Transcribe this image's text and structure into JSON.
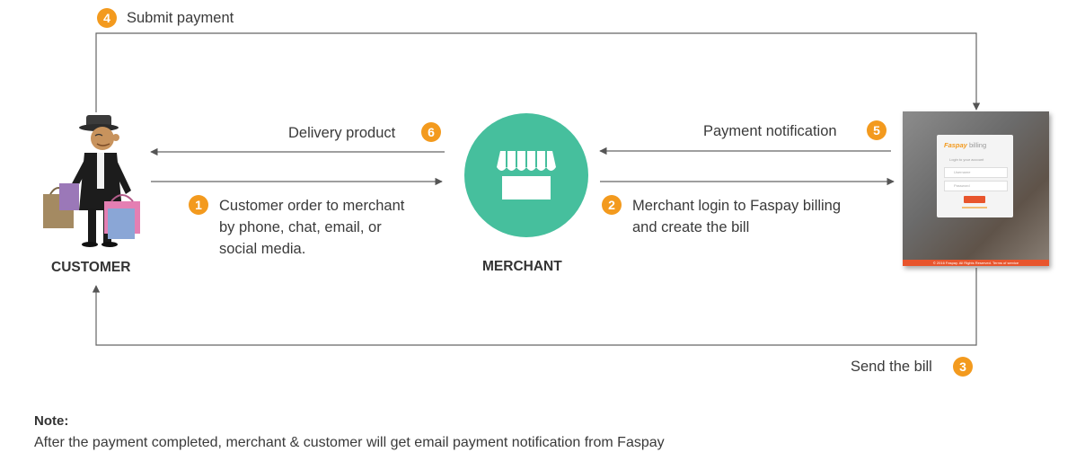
{
  "steps": {
    "s1": {
      "num": "1",
      "text": "Customer order to merchant\nby phone, chat, email, or\nsocial media."
    },
    "s2": {
      "num": "2",
      "text": "Merchant login to Faspay billing\nand create the bill"
    },
    "s3": {
      "num": "3",
      "text": "Send the bill"
    },
    "s4": {
      "num": "4",
      "text": "Submit payment"
    },
    "s5": {
      "num": "5",
      "text": "Payment notification"
    },
    "s6": {
      "num": "6",
      "text": "Delivery product"
    }
  },
  "actors": {
    "customer": "CUSTOMER",
    "merchant": "MERCHANT"
  },
  "screen": {
    "logo_brand": "Faspay",
    "logo_suffix": "billing",
    "subtitle": "Login to your account",
    "username_placeholder": "Username",
    "password_placeholder": "Password",
    "footer": "© 2016 Faspay. All Rights Reserved. Terms of service"
  },
  "note": {
    "title": "Note:",
    "body": "After the payment completed, merchant & customer will get email payment notification from Faspay"
  },
  "colors": {
    "badge": "#f39a1e",
    "merchant_circle": "#46bf9d",
    "arrows": "#555555"
  },
  "icons": {
    "customer": "customer-figure-icon",
    "merchant": "store-icon",
    "billing": "faspay-billing-screenshot"
  }
}
